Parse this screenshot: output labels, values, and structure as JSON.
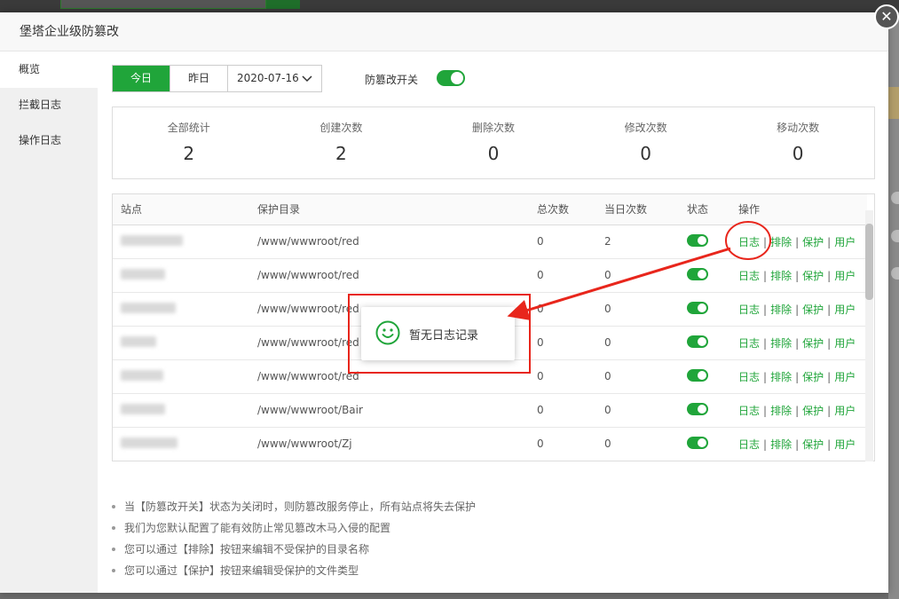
{
  "modal": {
    "title": "堡塔企业级防篡改"
  },
  "sidebar": {
    "items": [
      {
        "label": "概览"
      },
      {
        "label": "拦截日志"
      },
      {
        "label": "操作日志"
      }
    ]
  },
  "toolbar": {
    "tabs": [
      {
        "label": "今日"
      },
      {
        "label": "昨日"
      }
    ],
    "date_value": "2020-07-16",
    "switch_label": "防篡改开关",
    "switch_on": true
  },
  "stats": [
    {
      "label": "全部统计",
      "value": "2"
    },
    {
      "label": "创建次数",
      "value": "2"
    },
    {
      "label": "删除次数",
      "value": "0"
    },
    {
      "label": "修改次数",
      "value": "0"
    },
    {
      "label": "移动次数",
      "value": "0"
    }
  ],
  "table": {
    "columns": [
      "站点",
      "保护目录",
      "总次数",
      "当日次数",
      "状态",
      "操作"
    ],
    "rows": [
      {
        "dir": "/www/wwwroot/red",
        "total": "0",
        "today": "2"
      },
      {
        "dir": "/www/wwwroot/red",
        "total": "0",
        "today": "0"
      },
      {
        "dir": "/www/wwwroot/red",
        "total": "0",
        "today": "0"
      },
      {
        "dir": "/www/wwwroot/red",
        "total": "0",
        "today": "0"
      },
      {
        "dir": "/www/wwwroot/red",
        "total": "0",
        "today": "0"
      },
      {
        "dir": "/www/wwwroot/Bair",
        "total": "0",
        "today": "0"
      },
      {
        "dir": "/www/wwwroot/Zj",
        "total": "0",
        "today": "0"
      }
    ],
    "ops": {
      "log": "日志",
      "exclude": "排除",
      "protect": "保护",
      "user": "用户",
      "separator": "|"
    }
  },
  "tips": [
    "当【防篡改开关】状态为关闭时，则防篡改服务停止，所有站点将失去保护",
    "我们为您默认配置了能有效防止常见篡改木马入侵的配置",
    "您可以通过【排除】按钮来编辑不受保护的目录名称",
    "您可以通过【保护】按钮来编辑受保护的文件类型"
  ],
  "toast": {
    "text": "暂无日志记录",
    "icon": "smile-icon"
  },
  "colors": {
    "accent": "#20a53a",
    "annotation": "#e8261c"
  }
}
